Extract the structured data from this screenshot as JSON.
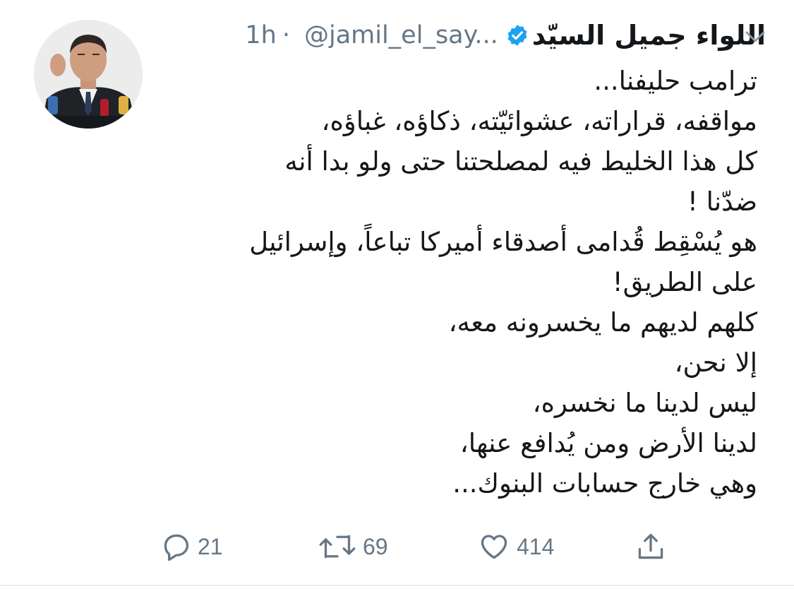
{
  "tweet": {
    "author": {
      "display_name": "اللواء جميل السيّد",
      "handle": "@jamil_el_say...",
      "verified": true,
      "avatar_icon": "person-at-microphones-avatar"
    },
    "separator": "·",
    "time": "1h",
    "text_lines": [
      "ترامب حليفنا...",
      "مواقفه، قراراته، عشوائيّته، ذكاؤه، غباؤه،",
      "كل هذا الخليط فيه لمصلحتنا حتى ولو بدا أنه",
      "ضدّنا !",
      "هو يُسْقِط قُدامى أصدقاء أميركا تباعاً، وإسرائيل",
      "على الطريق!",
      "كلهم لديهم ما يخسرونه معه،",
      "إلا نحن،",
      "ليس لدينا ما نخسره،",
      "لدينا الأرض ومن يُدافع عنها،",
      "وهي خارج حسابات البنوك..."
    ],
    "actions": {
      "reply": {
        "icon": "reply-bubble-icon",
        "count": "21"
      },
      "retweet": {
        "icon": "retweet-icon",
        "count": "69"
      },
      "like": {
        "icon": "heart-icon",
        "count": "414"
      },
      "share": {
        "icon": "share-icon",
        "count": ""
      }
    }
  },
  "colors": {
    "text": "#14171a",
    "muted": "#657786",
    "verified_blue": "#1da1f2",
    "divider": "#e6ecf0"
  }
}
